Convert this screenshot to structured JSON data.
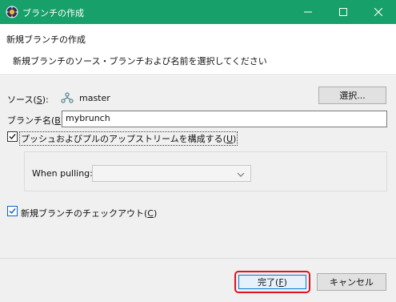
{
  "window": {
    "title": "ブランチの作成",
    "icons": {
      "app": "eclipse-gear-icon",
      "minimize": "minimize-icon",
      "maximize": "maximize-icon",
      "close": "close-icon"
    }
  },
  "header": {
    "title": "新規ブランチの作成",
    "description": "新規ブランチのソース・ブランチおよび名前を選択してください"
  },
  "form": {
    "source_label": "ソース(",
    "source_mnemonic": "S",
    "source_label_end": "):",
    "source_value": "master",
    "select_button": "選択...",
    "branch_name_label": "ブランチ名(",
    "branch_name_mnemonic": "B",
    "branch_name_label_end": "):",
    "branch_name_value": "mybrunch",
    "push_pull_checkbox": {
      "label": "プッシュおよびプルのアップストリームを構成する(",
      "mnemonic": "U",
      "label_end": ")",
      "checked": true
    },
    "when_pulling_label": "When pulling:",
    "when_pulling_value": "",
    "checkout_checkbox": {
      "label": "新規ブランチのチェックアウト(",
      "mnemonic": "C",
      "label_end": ")",
      "checked": true
    }
  },
  "buttons": {
    "finish": "完了(",
    "finish_mnemonic": "F",
    "finish_end": ")",
    "cancel": "キャンセル"
  },
  "colors": {
    "titlebar": "#18a06a",
    "highlight_border": "#e0141e",
    "default_button_border": "#0078d7"
  }
}
